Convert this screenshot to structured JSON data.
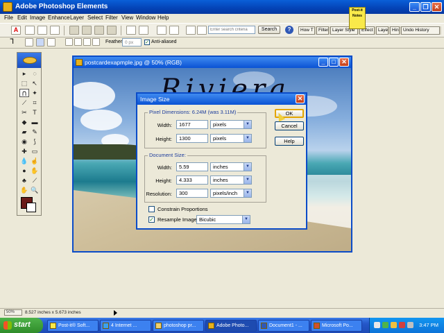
{
  "app": {
    "title": "Adobe Photoshop Elements"
  },
  "menu": [
    "File",
    "Edit",
    "Image",
    "Enhance",
    "Layer",
    "Select",
    "Filter",
    "View",
    "Window",
    "Help"
  ],
  "shortcuts": {
    "search_placeholder": "Enter search criteria",
    "search_button": "Search",
    "help_icon_label": "?"
  },
  "palette_well": [
    "How T",
    "Filter",
    "Layer Style",
    "Effect",
    "Layer",
    "Hin",
    "Undo History"
  ],
  "postit": {
    "line1": "Post-it",
    "line2": "Notes"
  },
  "options": {
    "feather_label": "Feather:",
    "feather_value": "0 px",
    "antialiased_label": "Anti-aliased"
  },
  "document": {
    "title": "postcardexapmple.jpg @ 50% (RGB)",
    "overlay_text": "Riviera Maya"
  },
  "dialog": {
    "title": "Image Size",
    "pixel_group": "Pixel Dimensions: 6.24M (was 3.11M)",
    "width_label": "Width:",
    "height_label": "Height:",
    "px_width": "1677",
    "px_height": "1300",
    "px_unit": "pixels",
    "doc_group": "Document Size:",
    "doc_width": "5.59",
    "doc_height": "4.333",
    "doc_unit": "inches",
    "resolution_label": "Resolution:",
    "resolution": "300",
    "resolution_unit": "pixels/inch",
    "constrain_label": "Constrain Proportions",
    "resample_label": "Resample Image:",
    "resample_value": "Bicubic",
    "ok": "OK",
    "cancel": "Cancel",
    "help": "Help"
  },
  "status": {
    "zoom": "50%",
    "dimensions": "8.527 inches x 5.673 inches"
  },
  "taskbar": {
    "start": "start",
    "tasks": [
      "Post-it® Soft...",
      "4 Internet ...",
      "photoshop pr...",
      "Adobe Photo...",
      "Document1 - ...",
      "Microsoft Po..."
    ],
    "clock": "3:47 PM"
  }
}
